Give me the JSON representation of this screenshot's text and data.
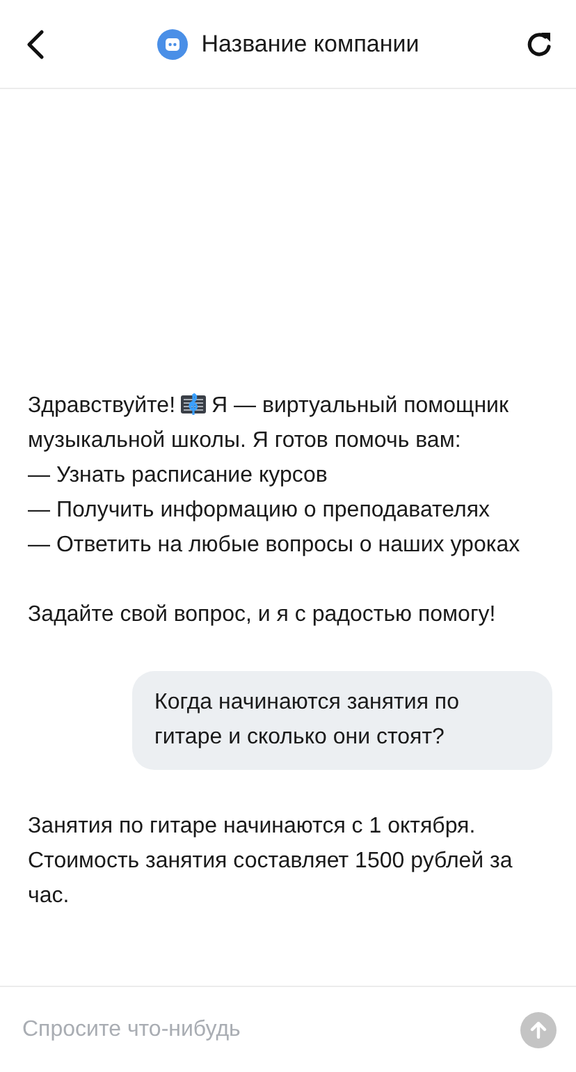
{
  "header": {
    "title": "Название компании"
  },
  "messages": [
    {
      "kind": "bot",
      "lead": "Здравствуйте!",
      "text": "Я — виртуальный помощник",
      "items": [
        "музыкальной школы. Я готов помочь вам:",
        "— Узнать расписание курсов",
        "— Получить информацию о преподавателях",
        "— Ответить на любые вопросы о наших уроках"
      ],
      "footer": "Задайте свой вопрос, и я с радостью помогу!"
    },
    {
      "kind": "user",
      "text": "Когда начинаются занятия по гитаре и сколько они стоят?"
    },
    {
      "kind": "bot",
      "text": "Занятия по гитаре начинаются с 1 октября. Стоимость занятия составляет 1500 рублей за час."
    }
  ],
  "composer": {
    "placeholder": "Спросите что-нибудь"
  }
}
